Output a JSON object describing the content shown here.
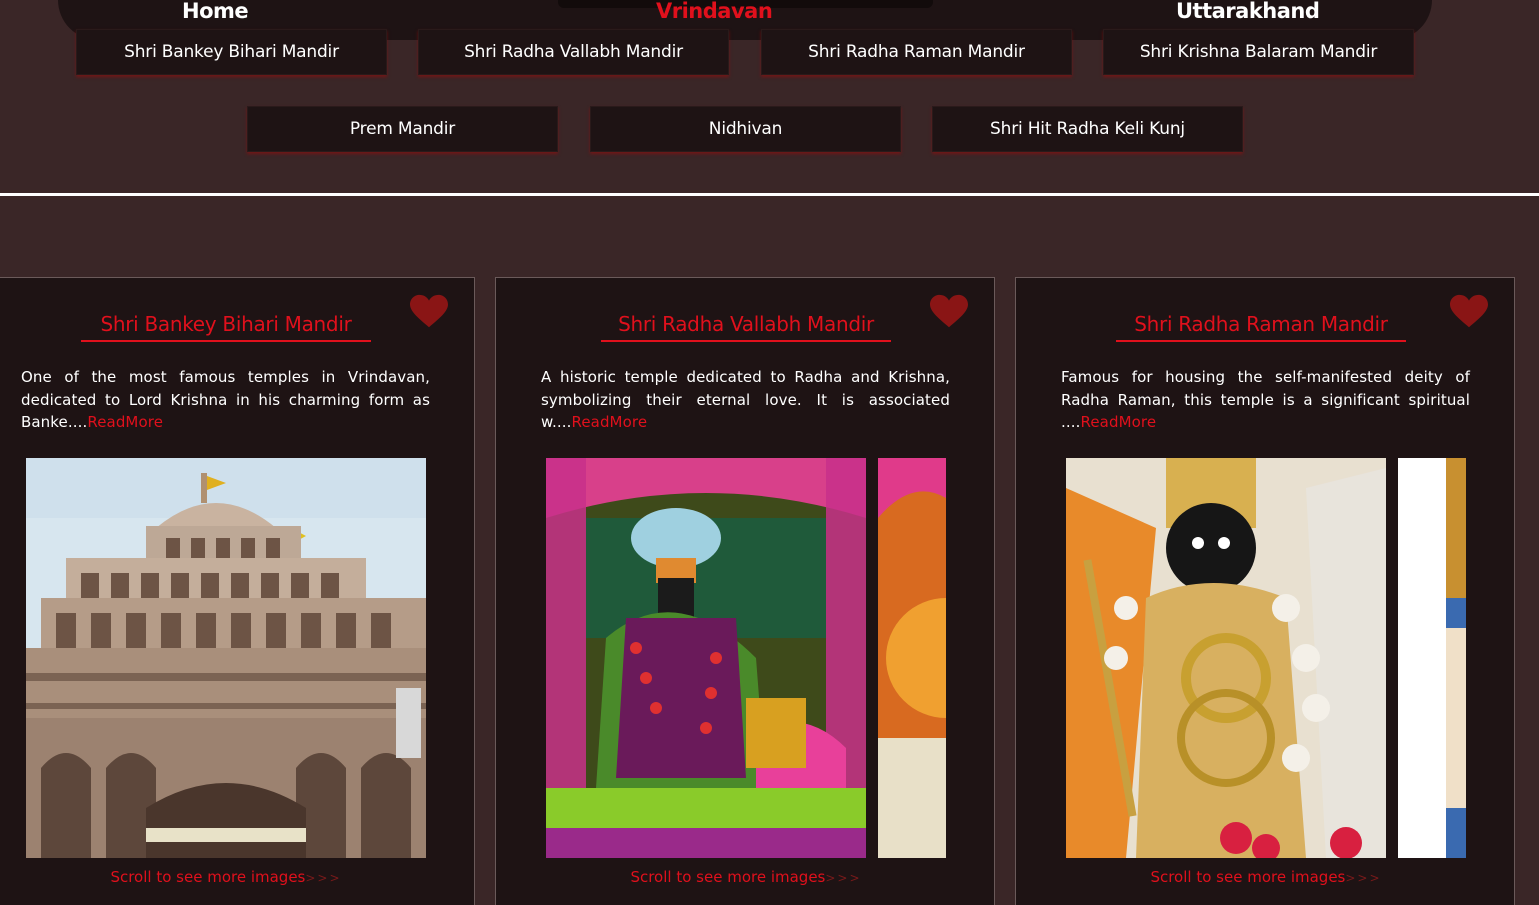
{
  "nav": {
    "home": "Home",
    "vrindavan": "Vrindavan",
    "uttarakhand": "Uttarakhand"
  },
  "temple_chips": [
    "Shri Bankey Bihari Mandir",
    "Shri Radha Vallabh Mandir",
    "Shri Radha Raman Mandir",
    "Shri Krishna Balaram Mandir",
    "Prem Mandir",
    "Nidhivan",
    "Shri Hit Radha Keli Kunj"
  ],
  "cards": [
    {
      "title": "Shri Bankey Bihari Mandir",
      "description": "One of the most famous temples in Vrindavan, dedicated to Lord Krishna in his charming form as Banke....",
      "read_more": "ReadMore",
      "scroll_hint": "Scroll to see more images",
      "scroll_arrows": ">>>"
    },
    {
      "title": "Shri Radha Vallabh Mandir",
      "description": "A historic temple dedicated to Radha and Krishna, symbolizing their eternal love. It is associated w....",
      "read_more": "ReadMore",
      "scroll_hint": "Scroll to see more images",
      "scroll_arrows": ">>>"
    },
    {
      "title": "Shri Radha Raman Mandir",
      "description": "Famous for housing the self-manifested deity of Radha Raman, this temple is a significant spiritual ....",
      "read_more": "ReadMore",
      "scroll_hint": "Scroll to see more images",
      "scroll_arrows": ">>>"
    }
  ],
  "colors": {
    "page_bg": "#3a2627",
    "panel_bg": "#1e1314",
    "accent": "#e0101c",
    "heart": "#8a1515"
  }
}
